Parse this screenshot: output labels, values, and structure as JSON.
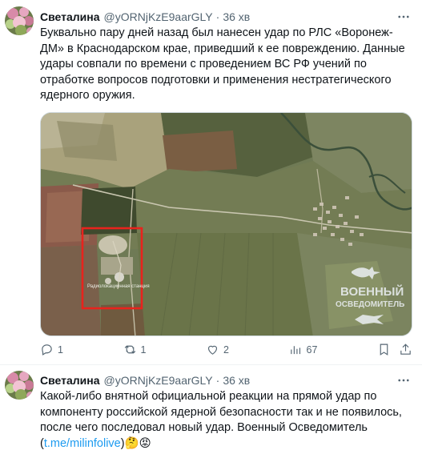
{
  "tweets": [
    {
      "author": {
        "display_name": "Светалина",
        "handle": "@yORNjKzE9aarGLY",
        "time": "36 хв"
      },
      "text": "Буквально пару дней назад был нанесен удар по РЛС «Воронеж-ДМ» в Краснодарском крае, приведший к ее повреждению. Данные удары совпали по времени с проведением ВС РФ учений по отработке вопросов подготовки и применения нестратегического ядерного оружия.",
      "media": {
        "type": "satellite-image",
        "map_label": "Радиолокационная станция",
        "watermark_line1": "ВОЕННЫЙ",
        "watermark_line2": "ОСВЕДОМИТЕЛЬ",
        "highlight_color": "#e8231d"
      },
      "actions": {
        "replies": "1",
        "retweets": "1",
        "likes": "2",
        "views": "67"
      }
    },
    {
      "author": {
        "display_name": "Светалина",
        "handle": "@yORNjKzE9aarGLY",
        "time": "36 хв"
      },
      "text_main": "Какой-либо  внятной официальной реакции на прямой удар по компоненту российской  ядерной безопасности так и не появилось, после чего последовал новый  удар.  Военный Осведомитель",
      "link_open": "(",
      "link_text": "t.me/milinfolive",
      "link_close": ")",
      "emojis": "🤔😡"
    }
  ],
  "icons": [
    "more-icon",
    "reply-icon",
    "retweet-icon",
    "like-icon",
    "views-icon",
    "bookmark-icon",
    "share-icon"
  ],
  "colors": {
    "accent": "#1d9bf0",
    "secondary_text": "#536471",
    "primary_text": "#0f1419",
    "divider": "#eff3f4"
  }
}
